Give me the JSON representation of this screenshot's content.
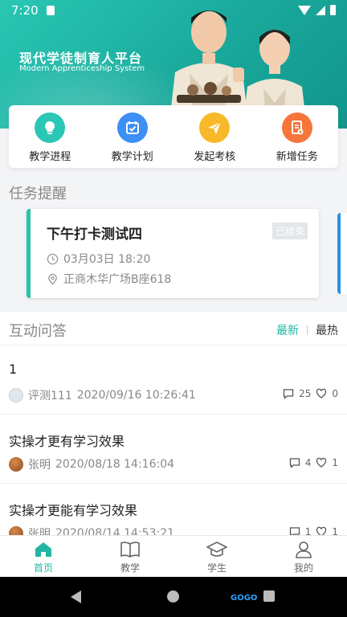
{
  "status_bar": {
    "time": "7:20"
  },
  "banner": {
    "title": "现代学徒制育人平台",
    "subtitle": "Modern Apprenticeship System"
  },
  "quick_actions": [
    {
      "label": "教学进程",
      "icon": "bulb-icon",
      "color": "#2cc6b5"
    },
    {
      "label": "教学计划",
      "icon": "calendar-check-icon",
      "color": "#3d8ef5"
    },
    {
      "label": "发起考核",
      "icon": "paper-plane-icon",
      "color": "#f7b928"
    },
    {
      "label": "新增任务",
      "icon": "document-add-icon",
      "color": "#f5753a"
    }
  ],
  "task_section": {
    "title": "任务提醒",
    "task": {
      "name": "下午打卡测试四",
      "status": "已结束",
      "time": "03月03日 18:20",
      "location": "正商木华广场B座618"
    }
  },
  "qa": {
    "title": "互动问答",
    "sort_newest": "最新",
    "sort_hottest": "最热",
    "posts": [
      {
        "title": "1",
        "author": "评测111",
        "date": "2020/09/16 10:26:41",
        "comments": "25",
        "likes": "0"
      },
      {
        "title": "实操才更有学习效果",
        "author": "张明",
        "date": "2020/08/18 14:16:04",
        "comments": "4",
        "likes": "1"
      },
      {
        "title": "实操才更能有学习效果",
        "author": "张明",
        "date": "2020/08/14 14:53:21",
        "comments": "1",
        "likes": "1"
      }
    ]
  },
  "tabbar": {
    "home": "首页",
    "teaching": "教学",
    "students": "学生",
    "mine": "我的"
  },
  "colors": {
    "accent": "#22b5a3",
    "task_border": "#28c3a7"
  },
  "watermark": "GOGO"
}
